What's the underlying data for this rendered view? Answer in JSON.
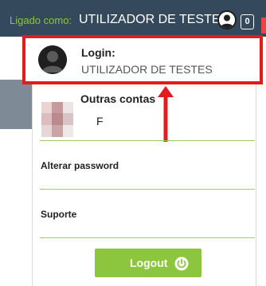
{
  "topbar": {
    "logged_as_label": "Ligado como:",
    "user_name": "UTILIZADOR DE TESTES",
    "notification_count": "0",
    "colors": {
      "bar": "#34495b",
      "label": "#8cc63f",
      "text": "#ffffff"
    }
  },
  "dropdown": {
    "login": {
      "title": "Login:",
      "user": "UTILIZADOR DE TESTES",
      "avatar_icon": "user-avatar-icon",
      "highlight_color": "#e21c1c"
    },
    "other_accounts": {
      "title": "Outras contas",
      "accounts": [
        {
          "name": "F",
          "avatar": "blurred-thumbnail"
        }
      ]
    },
    "change_password_label": "Alterar password",
    "support_label": "Suporte",
    "logout": {
      "label": "Logout",
      "icon": "power-icon",
      "color": "#8cc63f"
    },
    "divider_color": "#9ccd63"
  },
  "annotation": {
    "arrow_color": "#e21c1c",
    "arrow_icon": "arrow-up-icon"
  }
}
